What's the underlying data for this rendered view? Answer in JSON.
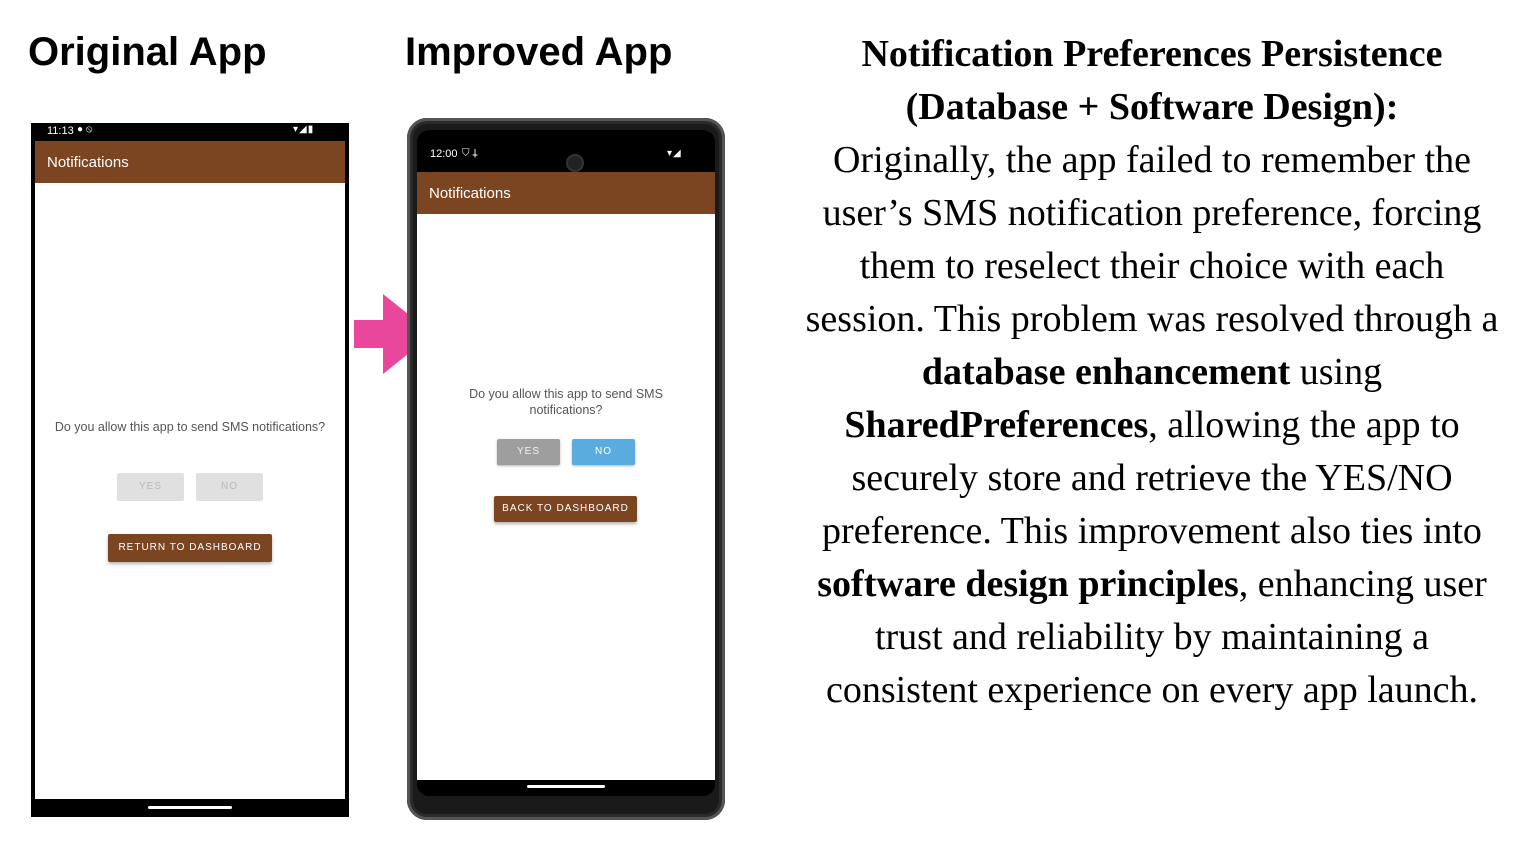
{
  "headings": {
    "original": "Original App",
    "improved": "Improved App"
  },
  "original_app": {
    "status_time": "11:13",
    "status_left_icons": "● ⦸",
    "status_right_icons": "▾◢▮",
    "app_title": "Notifications",
    "question": "Do you allow this app to send SMS notifications?",
    "yes_label": "YES",
    "no_label": "NO",
    "dashboard_button_label": "RETURN TO DASHBOARD"
  },
  "improved_app": {
    "status_time": "12:00",
    "status_left_icons": "⛉ ⸸",
    "status_right_icons": "▾◢",
    "app_title": "Notifications",
    "question": "Do you allow this app to send SMS notifications?",
    "yes_label": "YES",
    "no_label": "NO",
    "dashboard_button_label": "BACK TO DASHBOARD",
    "selected_option": "NO"
  },
  "arrow": {
    "icon": "right-arrow-icon",
    "color": "#e8479b"
  },
  "description": {
    "title_line1": "Notification Preferences Persistence",
    "title_line2": "(Database + Software Design):",
    "p1": "Originally, the app failed to remember the user’s SMS notification preference, forcing them to reselect their choice with each session. This problem was resolved through a ",
    "b1": "database enhancement",
    "p2": " using ",
    "b2": "SharedPreferences",
    "p3": ", allowing the app to securely store and retrieve the YES/NO preference. This improvement also ties into ",
    "b3": "software design principles",
    "p4": ", enhancing user trust and reliability by maintaining a consistent experience on every app launch."
  },
  "colors": {
    "appbar": "#7b4522",
    "brown_button": "#7b4522",
    "selected_blue": "#5aacde",
    "unselected_grey": "#9e9e9e",
    "disabled_grey": "#e0e0e0"
  }
}
